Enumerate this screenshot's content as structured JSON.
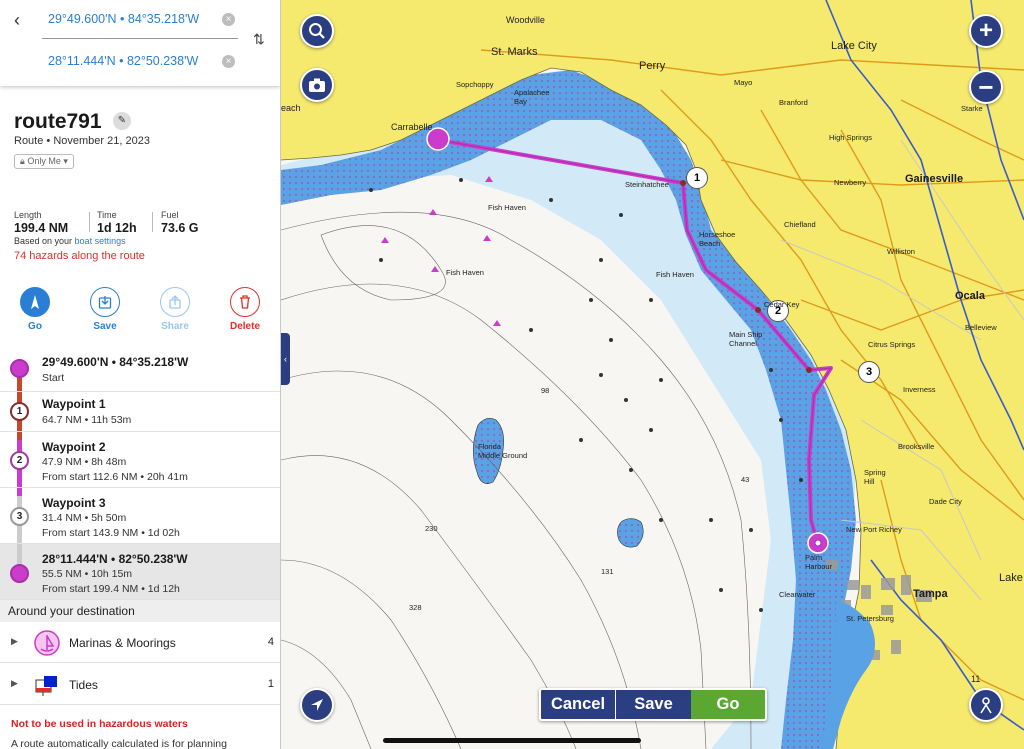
{
  "search": {
    "origin": "29°49.600'N • 84°35.218'W",
    "destination": "28°11.444'N • 82°50.238'W"
  },
  "route": {
    "name": "route791",
    "subtitle": "Route • November 21, 2023",
    "privacy": "Only Me",
    "length_label": "Length",
    "length_value": "199.4 NM",
    "time_label": "Time",
    "time_value": "1d 12h",
    "fuel_label": "Fuel",
    "fuel_value": "73.6 G",
    "based_on": "Based on your ",
    "based_on_link": "boat settings",
    "hazards": "74 hazards along the route"
  },
  "actions": [
    {
      "label": "Go",
      "icon": "navigate-icon"
    },
    {
      "label": "Save",
      "icon": "download-icon"
    },
    {
      "label": "Share",
      "icon": "share-icon"
    },
    {
      "label": "Delete",
      "icon": "trash-icon"
    }
  ],
  "waypoints": [
    {
      "marker": "",
      "title": "29°49.600'N • 84°35.218'W",
      "line1": "Start",
      "line2": ""
    },
    {
      "marker": "1",
      "title": "Waypoint 1",
      "line1": "64.7 NM • 11h 53m",
      "line2": ""
    },
    {
      "marker": "2",
      "title": "Waypoint 2",
      "line1": "47.9 NM • 8h 48m",
      "line2": "From start 112.6 NM • 20h 41m"
    },
    {
      "marker": "3",
      "title": "Waypoint 3",
      "line1": "31.4 NM • 5h 50m",
      "line2": "From start 143.9 NM • 1d 02h"
    },
    {
      "marker": "",
      "title": "28°11.444'N • 82°50.238'W",
      "line1": "55.5 NM • 10h 15m",
      "line2": "From start 199.4 NM • 1d 12h"
    }
  ],
  "around": {
    "heading": "Around your destination",
    "items": [
      {
        "label": "Marinas & Moorings",
        "count": "4",
        "icon": "marina-icon"
      },
      {
        "label": "Tides",
        "count": "1",
        "icon": "tides-icon"
      }
    ]
  },
  "disclaimer": {
    "warning": "Not to be used in hazardous waters",
    "note": "A route automatically calculated is for planning"
  },
  "map": {
    "bottom_bar": {
      "cancel": "Cancel",
      "save": "Save",
      "go": "Go"
    },
    "labels": {
      "woodville": "Woodville",
      "st_marks": "St. Marks",
      "perry": "Perry",
      "lake_city": "Lake City",
      "gainesville": "Gainesville",
      "ocala": "Ocala",
      "tampa": "Tampa",
      "carrabelle": "Carrabelle",
      "sopchoppy": "Sopchoppy",
      "apalachee_bay": "Apalachee\nBay",
      "steinhatchee": "Steinhatchee",
      "fish_haven_1": "Fish Haven",
      "fish_haven_2": "Fish Haven",
      "fish_haven_3": "Fish Haven",
      "horseshoe_beach": "Horseshoe\nBeach",
      "cedar_key": "Cedar Key",
      "main_ship_channel": "Main Ship\nChannel",
      "florida_middle_ground": "Florida\nMiddle Ground",
      "citrus_springs": "Citrus Springs",
      "inverness": "Inverness",
      "brooksville": "Brooksville",
      "new_port_richey": "New Port Richey",
      "palm_harbour": "Palm\nHarbour",
      "clearwater": "Clearwater",
      "st_petersburg": "St. Petersburg",
      "high_springs": "High Springs",
      "newberry": "Newberry",
      "chiefland": "Chiefland",
      "williston": "Williston",
      "belleview": "Belleview",
      "branford": "Branford",
      "mayo": "Mayo",
      "spring_hill": "Spring\nHill",
      "dade_city": "Dade City",
      "lake_partial": "Lake",
      "starke_partial": "Starke",
      "beach_partial": "each",
      "depth_98": "98",
      "depth_43": "43",
      "depth_230": "230",
      "depth_131": "131",
      "depth_328": "328",
      "route_badge_1": "1",
      "route_badge_2": "2",
      "route_badge_3": "3",
      "interstate_11": "11"
    }
  },
  "colors": {
    "land": "#f5ea6e",
    "shallow_water": "#5aa2e6",
    "light_water": "#cfe8f7",
    "route": "#cc3ccc",
    "button": "#2b3e82",
    "go": "#5aa832",
    "hazard_text": "#e0302a"
  }
}
